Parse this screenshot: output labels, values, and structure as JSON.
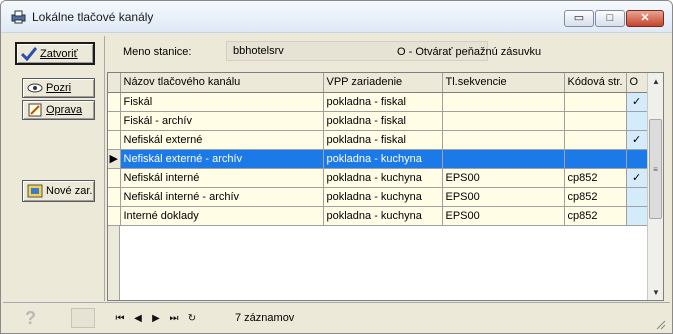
{
  "window": {
    "title": "Lokálne tlačové kanály",
    "buttons": {
      "minimize": "▭",
      "maximize": "□",
      "close": "✕"
    }
  },
  "left_panel": {
    "close_label": "Zatvoriť",
    "view_label": "Pozri",
    "edit_label": "Oprava",
    "new_device_label": "Nové zar."
  },
  "header": {
    "station_label": "Meno stanice:",
    "station_value": "bbhotelsrv",
    "drawer_note": "O - Otvárať peňažnú zásuvku"
  },
  "grid": {
    "columns": [
      "Názov tlačového kanálu",
      "VPP zariadenie",
      "Tl.sekvencie",
      "Kódová str.",
      "O"
    ],
    "rows": [
      {
        "name": "Fiskál",
        "vpp": "pokladna - fiskal",
        "seq": "",
        "code": "",
        "o": "✓"
      },
      {
        "name": "Fiskál - archív",
        "vpp": "pokladna - fiskal",
        "seq": "",
        "code": "",
        "o": ""
      },
      {
        "name": "Nefiskál externé",
        "vpp": "pokladna - fiskal",
        "seq": "",
        "code": "",
        "o": "✓"
      },
      {
        "name": "Nefiskál externé - archív",
        "vpp": "pokladna - kuchyna",
        "seq": "",
        "code": "",
        "o": ""
      },
      {
        "name": "Nefiskál interné",
        "vpp": "pokladna - kuchyna",
        "seq": "EPS00",
        "code": "cp852",
        "o": "✓"
      },
      {
        "name": "Nefiskál interné - archív",
        "vpp": "pokladna - kuchyna",
        "seq": "EPS00",
        "code": "cp852",
        "o": ""
      },
      {
        "name": "Interné doklady",
        "vpp": "pokladna - kuchyna",
        "seq": "EPS00",
        "code": "cp852",
        "o": ""
      }
    ],
    "selected_row": 3,
    "row_indicator": "▶"
  },
  "status": {
    "help": "?",
    "nav": {
      "first": "⏮",
      "prev": "◀",
      "next": "▶",
      "last": "⏭",
      "refresh": "↻"
    },
    "record_count": "7 záznamov"
  },
  "colors": {
    "accent": "#1c7ae8",
    "row_bg": "#fffde6",
    "check_col_bg": "#d4ebfa"
  }
}
